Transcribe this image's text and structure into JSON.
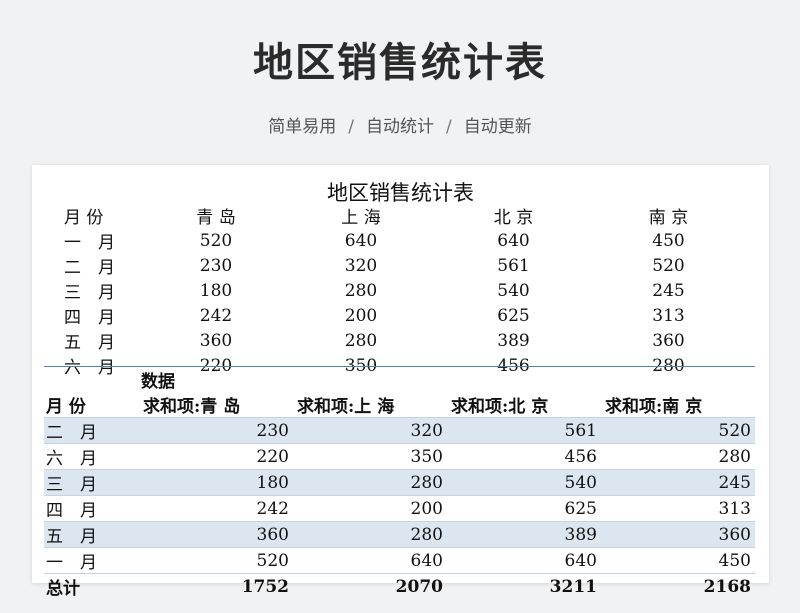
{
  "header": {
    "title": "地区销售统计表",
    "tags": [
      "简单易用",
      "自动统计",
      "自动更新"
    ],
    "separator": "/"
  },
  "sheet": {
    "title": "地区销售统计表",
    "raw_table": {
      "headers": [
        "月 份",
        "青 岛",
        "上 海",
        "北 京",
        "南 京"
      ],
      "rows": [
        [
          "一　月",
          "520",
          "640",
          "640",
          "450"
        ],
        [
          "二　月",
          "230",
          "320",
          "561",
          "520"
        ],
        [
          "三　月",
          "180",
          "280",
          "540",
          "245"
        ],
        [
          "四　月",
          "242",
          "200",
          "625",
          "313"
        ],
        [
          "五　月",
          "360",
          "280",
          "389",
          "360"
        ],
        [
          "六　月",
          "220",
          "350",
          "456",
          "280"
        ]
      ]
    },
    "pivot_table": {
      "data_label": "数据",
      "row_label": "月 份",
      "headers": [
        "求和项:青 岛",
        "求和项:上 海",
        "求和项:北 京",
        "求和项:南 京"
      ],
      "rows": [
        [
          "二　月",
          "230",
          "320",
          "561",
          "520"
        ],
        [
          "六　月",
          "220",
          "350",
          "456",
          "280"
        ],
        [
          "三　月",
          "180",
          "280",
          "540",
          "245"
        ],
        [
          "四　月",
          "242",
          "200",
          "625",
          "313"
        ],
        [
          "五　月",
          "360",
          "280",
          "389",
          "360"
        ],
        [
          "一　月",
          "520",
          "640",
          "640",
          "450"
        ]
      ],
      "total_label": "总计",
      "totals": [
        "1752",
        "2070",
        "3211",
        "2168"
      ]
    }
  }
}
